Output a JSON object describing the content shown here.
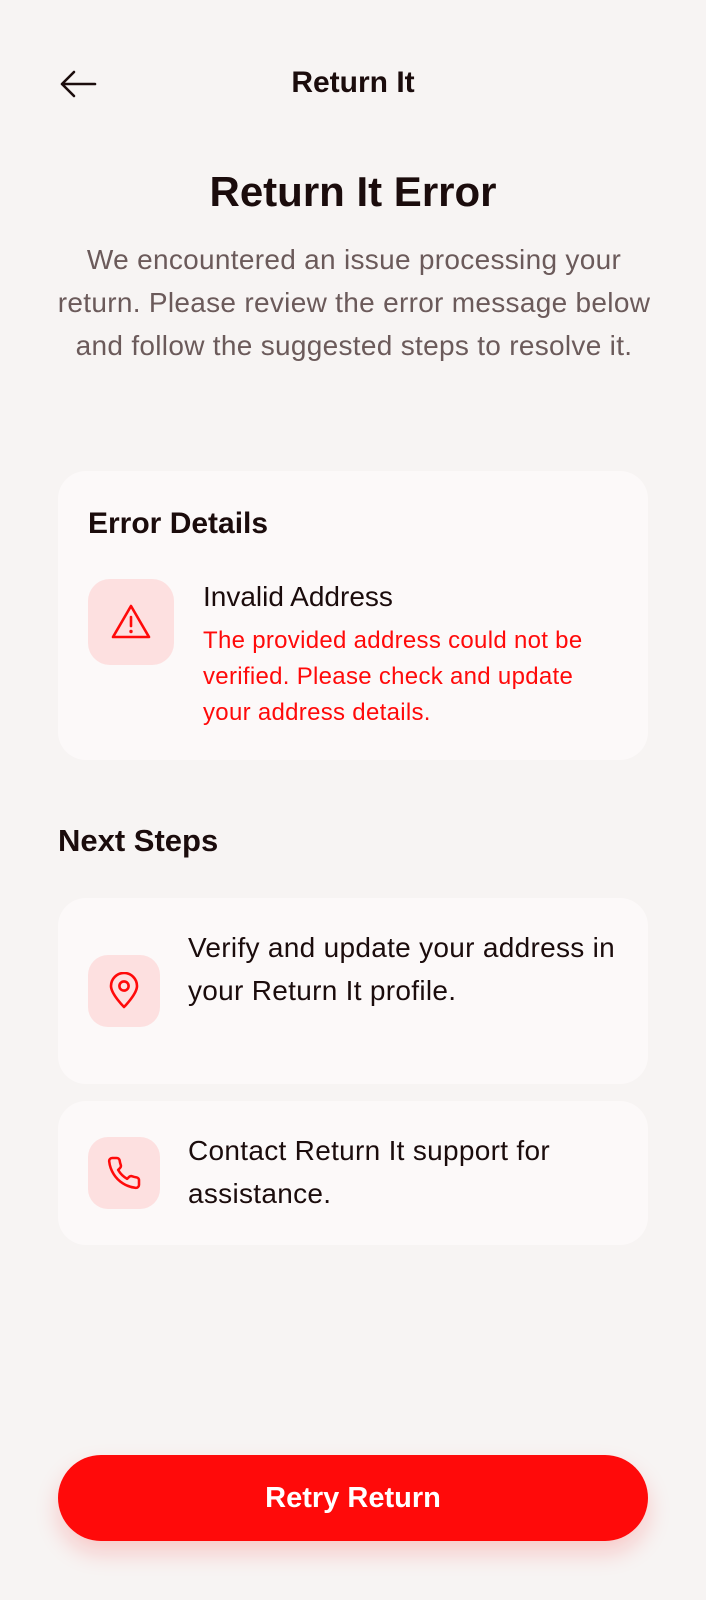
{
  "header": {
    "title": "Return It",
    "back_icon": "arrow-left-icon"
  },
  "main": {
    "title": "Return It Error",
    "subtitle": "We encountered an issue processing your return. Please review the error message below and follow the suggested steps to resolve it."
  },
  "error_card": {
    "title": "Error Details",
    "icon": "warning-triangle-icon",
    "error_name": "Invalid Address",
    "error_description": "The provided address could not be verified. Please check and update your address details."
  },
  "next_steps": {
    "title": "Next Steps",
    "items": [
      {
        "icon": "map-pin-icon",
        "text": "Verify and update your address in your Return It profile."
      },
      {
        "icon": "phone-icon",
        "text": "Contact Return It support for assistance."
      }
    ]
  },
  "actions": {
    "retry_label": "Retry Return"
  },
  "colors": {
    "accent": "#ff0a0a",
    "icon_tile_bg": "#fde0e0",
    "background": "#f7f4f3",
    "card_bg": "#fcf9f9",
    "text_primary": "#1b0c0c",
    "text_secondary": "#6b5a5a"
  }
}
